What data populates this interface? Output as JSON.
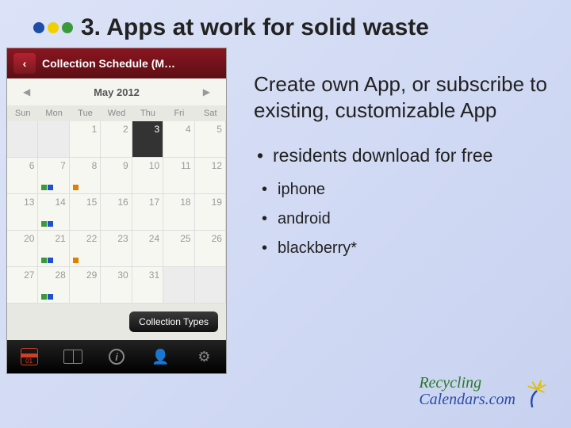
{
  "title": "3. Apps at work for solid waste",
  "phone": {
    "header_title": "Collection Schedule (M…",
    "back_glyph": "‹",
    "month_label": "May 2012",
    "weekdays": [
      "Sun",
      "Mon",
      "Tue",
      "Wed",
      "Thu",
      "Fri",
      "Sat"
    ],
    "types_button": "Collection Types",
    "tab_calendar_day": "01",
    "cells": [
      {
        "n": "",
        "blank": true
      },
      {
        "n": "",
        "blank": true
      },
      {
        "n": "1"
      },
      {
        "n": "2"
      },
      {
        "n": "3",
        "selected": true
      },
      {
        "n": "4"
      },
      {
        "n": "5"
      },
      {
        "n": "6"
      },
      {
        "n": "7",
        "marks": [
          "g",
          "b"
        ]
      },
      {
        "n": "8",
        "marks": [
          "o"
        ]
      },
      {
        "n": "9"
      },
      {
        "n": "10"
      },
      {
        "n": "11"
      },
      {
        "n": "12"
      },
      {
        "n": "13"
      },
      {
        "n": "14",
        "marks": [
          "g",
          "b"
        ]
      },
      {
        "n": "15"
      },
      {
        "n": "16"
      },
      {
        "n": "17"
      },
      {
        "n": "18"
      },
      {
        "n": "19"
      },
      {
        "n": "20"
      },
      {
        "n": "21",
        "marks": [
          "g",
          "b"
        ]
      },
      {
        "n": "22",
        "marks": [
          "o"
        ]
      },
      {
        "n": "23"
      },
      {
        "n": "24"
      },
      {
        "n": "25"
      },
      {
        "n": "26"
      },
      {
        "n": "27"
      },
      {
        "n": "28",
        "marks": [
          "g",
          "b"
        ]
      },
      {
        "n": "29"
      },
      {
        "n": "30"
      },
      {
        "n": "31"
      },
      {
        "n": "",
        "blank": true
      },
      {
        "n": "",
        "blank": true
      }
    ]
  },
  "right": {
    "lead": "Create own App, or subscribe to existing, customizable App",
    "b1": "residents download for free",
    "b2": "iphone",
    "b3": "android",
    "b4": "blackberry*"
  },
  "logo": {
    "line1": "Recycling",
    "line2": "Calendars.com"
  }
}
